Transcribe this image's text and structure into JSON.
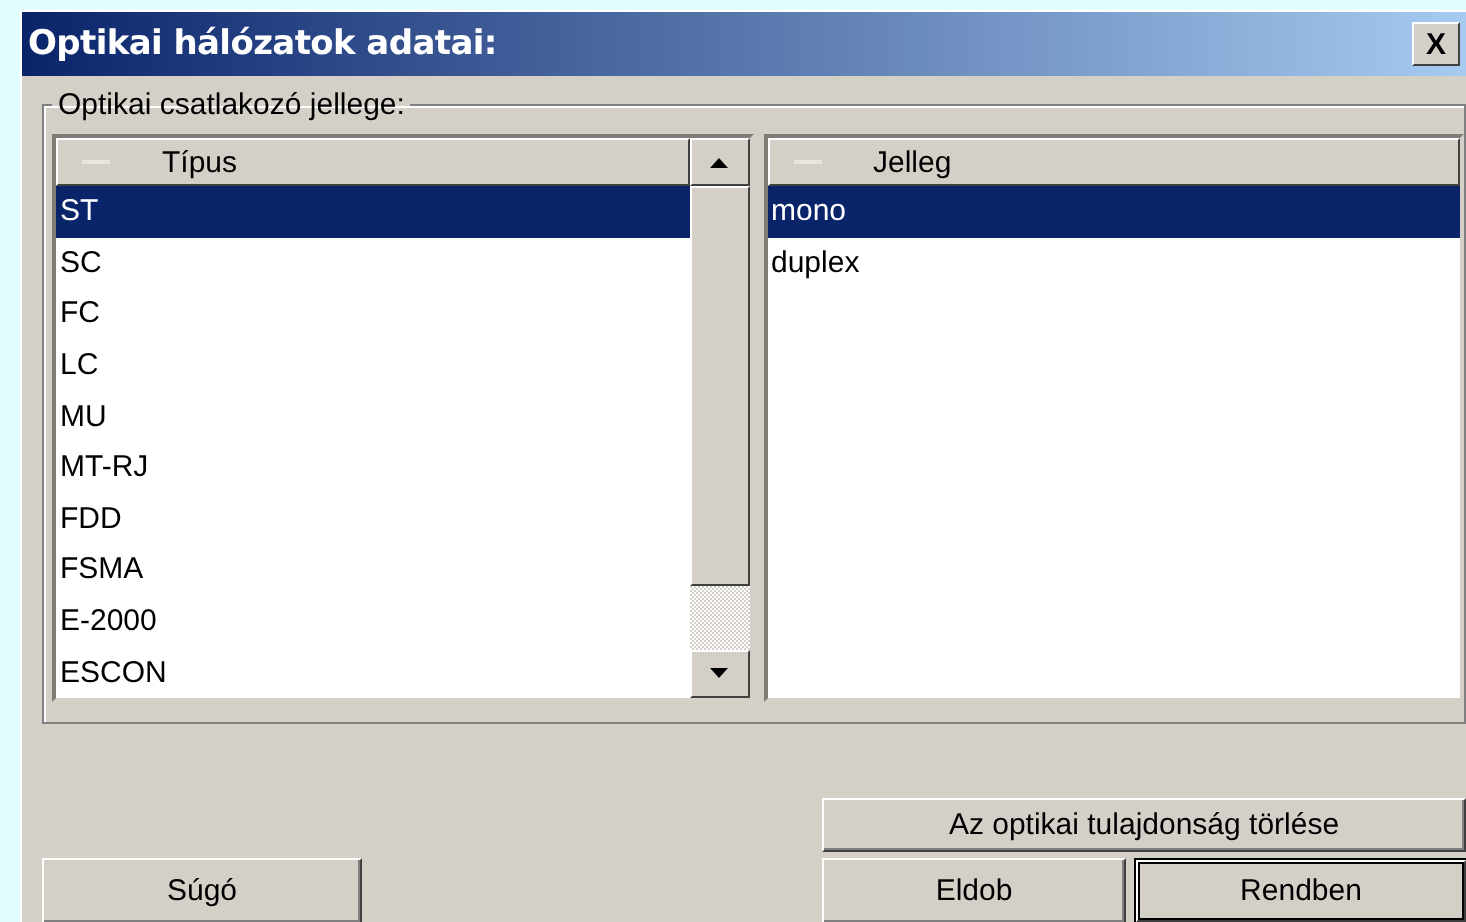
{
  "window": {
    "title": "Optikai hálózatok adatai:",
    "close": "X"
  },
  "group": {
    "label": "Optikai csatlakozó jellege:"
  },
  "lists": [
    {
      "header": "Típus",
      "scrollbar": true,
      "items": [
        {
          "label": "ST",
          "selected": true
        },
        {
          "label": "SC",
          "selected": false
        },
        {
          "label": "FC",
          "selected": false
        },
        {
          "label": "LC",
          "selected": false
        },
        {
          "label": "MU",
          "selected": false
        },
        {
          "label": "MT-RJ",
          "selected": false
        },
        {
          "label": "FDD",
          "selected": false
        },
        {
          "label": "FSMA",
          "selected": false
        },
        {
          "label": "E-2000",
          "selected": false
        },
        {
          "label": "ESCON",
          "selected": false
        }
      ]
    },
    {
      "header": "Jelleg",
      "scrollbar": false,
      "items": [
        {
          "label": "mono",
          "selected": true
        },
        {
          "label": "duplex",
          "selected": false
        }
      ]
    }
  ],
  "buttons": {
    "delete": "Az optikai tulajdonság törlése",
    "help": "Súgó",
    "cancel": "Eldob",
    "ok": {
      "label": "Rendben",
      "default": true
    }
  }
}
